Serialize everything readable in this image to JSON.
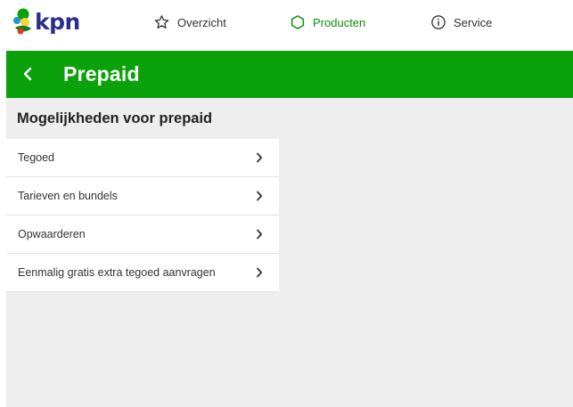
{
  "brand": {
    "logo_text": "kpn",
    "brand_color": "#2a2f8a",
    "accent_green": "#0aa10a"
  },
  "topnav": {
    "items": [
      {
        "label": "Overzicht",
        "icon": "star-outline-icon",
        "active": false
      },
      {
        "label": "Producten",
        "icon": "hexagon-outline-icon",
        "active": true
      },
      {
        "label": "Service",
        "icon": "info-circle-icon",
        "active": false
      }
    ]
  },
  "header": {
    "back_icon": "chevron-left-icon",
    "title": "Prepaid"
  },
  "main": {
    "section_title": "Mogelijkheden voor prepaid",
    "menu": [
      {
        "label": "Tegoed",
        "icon": "chevron-right-icon"
      },
      {
        "label": "Tarieven en bundels",
        "icon": "chevron-right-icon"
      },
      {
        "label": "Opwaarderen",
        "icon": "chevron-right-icon"
      },
      {
        "label": "Eenmalig gratis extra tegoed aanvragen",
        "icon": "chevron-right-icon"
      }
    ]
  }
}
